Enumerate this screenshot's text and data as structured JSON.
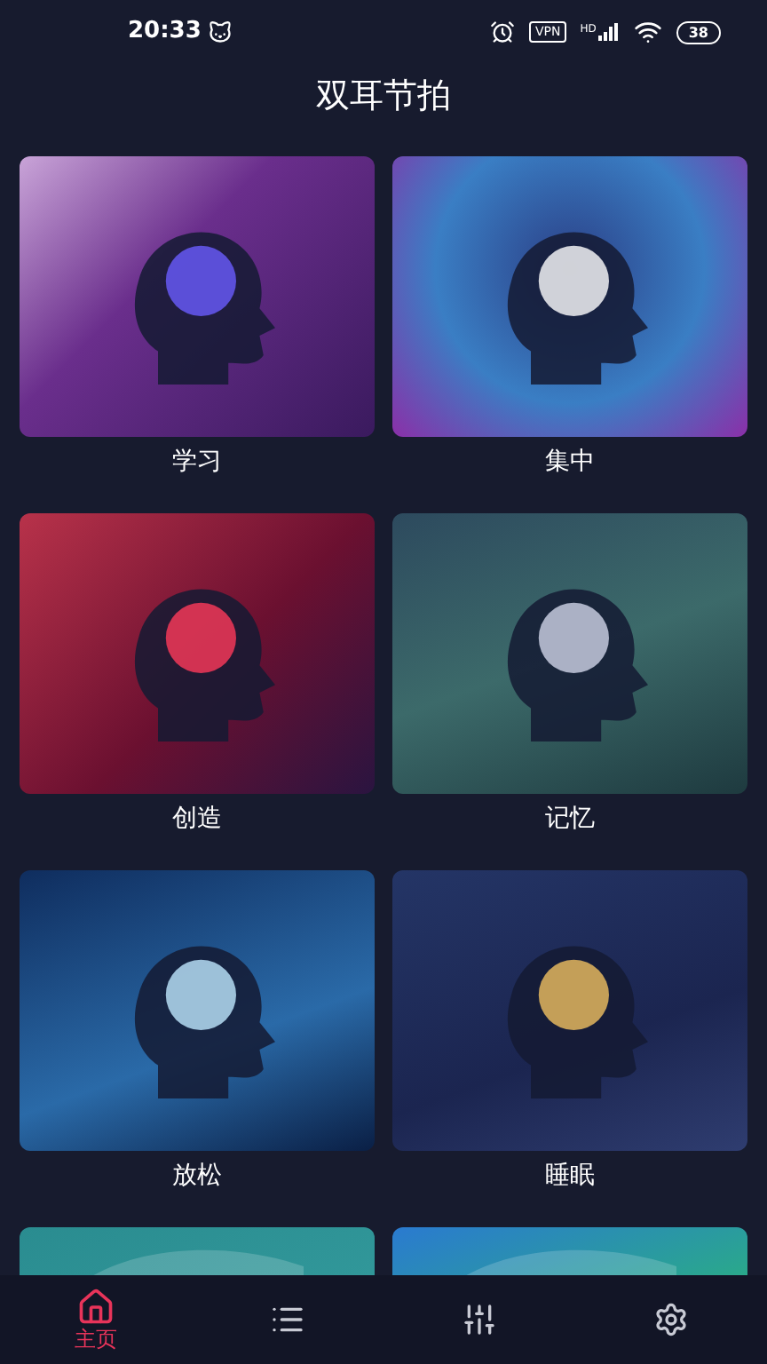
{
  "status_bar": {
    "time": "20:33",
    "vpn": "VPN",
    "network": "HD",
    "battery": "38"
  },
  "title": "双耳节拍",
  "cards": [
    {
      "label": "学习"
    },
    {
      "label": "集中"
    },
    {
      "label": "创造"
    },
    {
      "label": "记忆"
    },
    {
      "label": "放松"
    },
    {
      "label": "睡眠"
    },
    {
      "kind": "cut_off"
    },
    {
      "kind": "cut_off"
    }
  ],
  "nav": [
    {
      "kind": "home",
      "label": "主页",
      "selected": true
    },
    {
      "kind": "list",
      "selected": false
    },
    {
      "kind": "sliders",
      "selected": false
    },
    {
      "kind": "settings",
      "selected": false
    }
  ]
}
